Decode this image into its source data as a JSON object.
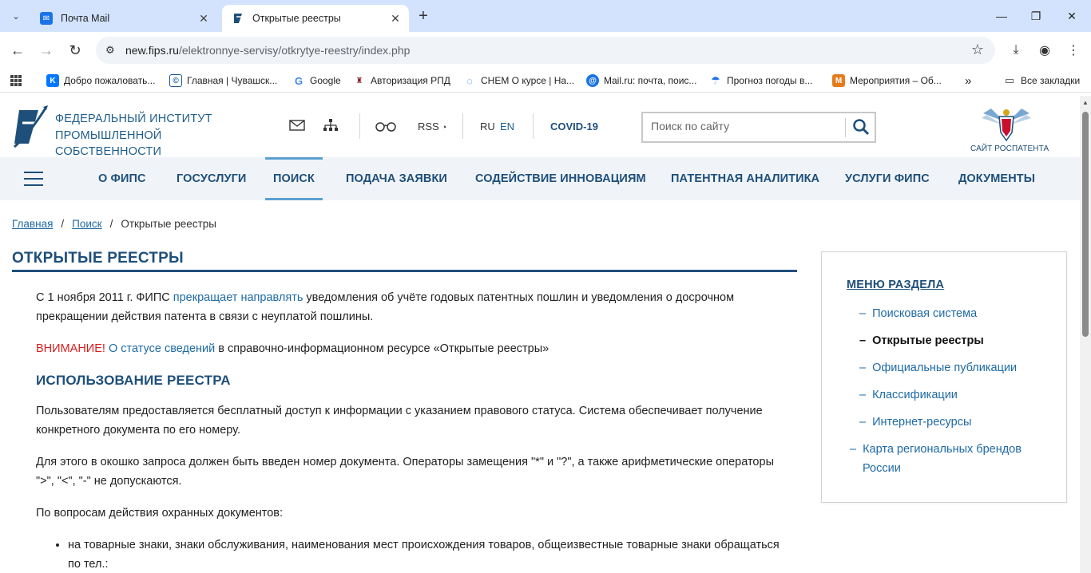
{
  "browser": {
    "tabs": [
      {
        "title": "Почта Mail",
        "active": false
      },
      {
        "title": "Открытые реестры",
        "active": true
      }
    ],
    "url_host": "new.fips.ru",
    "url_path": "/elektronnye-servisy/otkrytye-reestry/index.php",
    "bookmarks": [
      "Добро пожаловать...",
      "Главная | Чувашск...",
      "Google",
      "Авторизация РПД",
      "CHEM О курсе | На...",
      "Mail.ru: почта, поис...",
      "Прогноз погоды в...",
      "Мероприятия – Об..."
    ],
    "all_bookmarks": "Все закладки"
  },
  "header": {
    "org_line1": "ФЕДЕРАЛЬНЫЙ ИНСТИТУТ",
    "org_line2": "ПРОМЫШЛЕННОЙ",
    "org_line3": "СОБСТВЕННОСТИ",
    "rss": "RSS",
    "lang_ru": "RU",
    "lang_en": "EN",
    "covid": "COVID-19",
    "search_placeholder": "Поиск по сайту",
    "rospatent": "САЙТ РОСПАТЕНТА"
  },
  "nav": {
    "items": [
      "О ФИПС",
      "ГОСУСЛУГИ",
      "ПОИСК",
      "ПОДАЧА ЗАЯВКИ",
      "СОДЕЙСТВИЕ ИННОВАЦИЯМ",
      "ПАТЕНТНАЯ АНАЛИТИКА",
      "УСЛУГИ ФИПС",
      "ДОКУМЕНТЫ"
    ],
    "active": "ПОИСК"
  },
  "breadcrumb": {
    "home": "Главная",
    "search": "Поиск",
    "sep": "/",
    "current": "Открытые реестры"
  },
  "page": {
    "title": "ОТКРЫТЫЕ РЕЕСТРЫ",
    "p1_before": "С 1 ноября 2011 г. ФИПС ",
    "p1_link": "прекращает направлять",
    "p1_after": " уведомления об учёте годовых патентных пошлин и уведомления о досрочном прекращении действия патента в связи с неуплатой пошлины.",
    "p2_warn": "ВНИМАНИЕ!",
    "p2_link": "О статусе сведений",
    "p2_after": " в справочно-информационном ресурсе «Открытые реестры»",
    "h2": "ИСПОЛЬЗОВАНИЕ РЕЕСТРА",
    "p3": "Пользователям предоставляется бесплатный доступ к информации с указанием правового статуса. Система обеспечивает получение конкретного документа по его номеру.",
    "p4": "Для этого в окошко запроса должен быть введен номер документа. Операторы замещения \"*\" и \"?\", а также арифметические операторы \">\", \"<\", \"-\" не допускаются.",
    "p5": "По вопросам действия охранных документов:",
    "li1": "на товарные знаки, знаки обслуживания, наименования мест происхождения товаров, общеизвестные товарные знаки обращаться по тел.:"
  },
  "sidebar": {
    "title": "МЕНЮ РАЗДЕЛА",
    "dash": "–",
    "items": [
      "Поисковая система",
      "Открытые реестры",
      "Официальные публикации",
      "Классификации",
      "Интернет-ресурсы",
      "Карта региональных брендов России"
    ],
    "current": "Открытые реестры"
  },
  "colors": {
    "brand": "#1e4f7a",
    "link": "#1e6aa5",
    "warning": "#d81e1e",
    "nav_bg": "#f0f4f8",
    "tabbar_bg": "#d3e3fd"
  }
}
